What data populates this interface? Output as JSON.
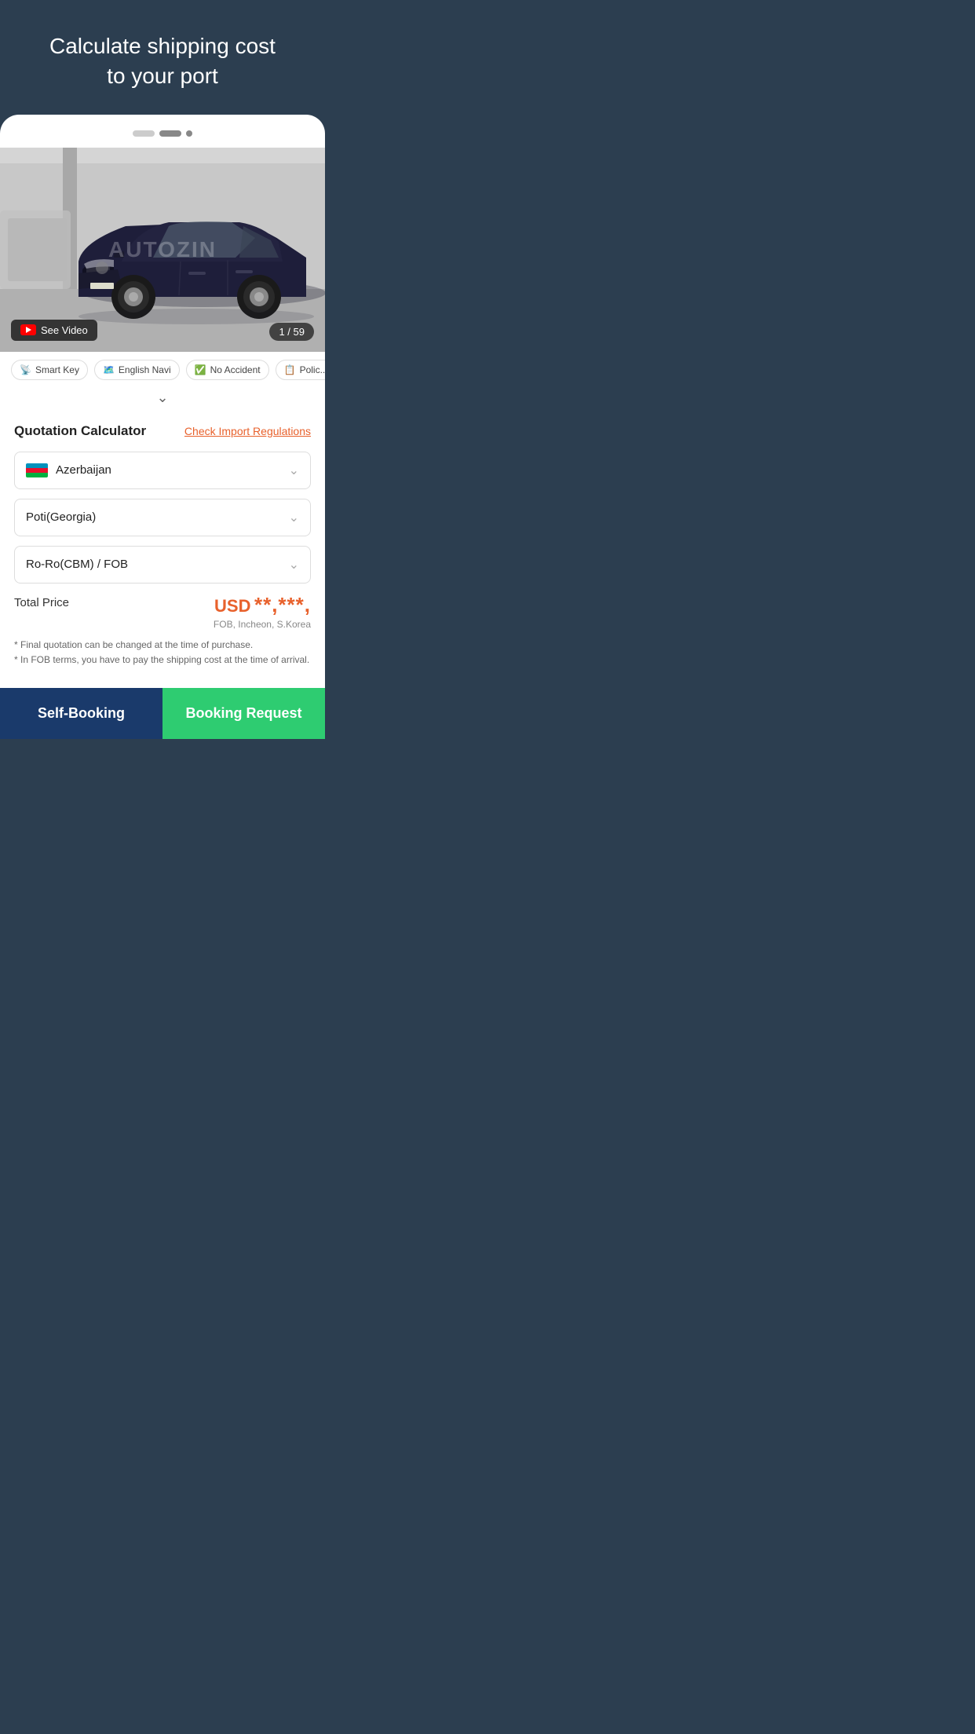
{
  "hero": {
    "title": "Calculate shipping cost\nto your port"
  },
  "pagination": {
    "dots": [
      {
        "type": "long",
        "active": false
      },
      {
        "type": "circle",
        "active": true
      },
      {
        "type": "circle-small",
        "active": true
      }
    ]
  },
  "car_image": {
    "see_video_label": "See Video",
    "counter": "1 / 59",
    "watermark": "AUTOZIN"
  },
  "features": [
    {
      "icon": "📡",
      "label": "Smart Key"
    },
    {
      "icon": "🗺️",
      "label": "English Navi"
    },
    {
      "icon": "✅",
      "label": "No Accident"
    },
    {
      "icon": "📋",
      "label": "Polic..."
    }
  ],
  "quotation": {
    "title": "Quotation Calculator",
    "check_import_link": "Check Import Regulations",
    "country_dropdown": {
      "value": "Azerbaijan",
      "has_flag": true
    },
    "port_dropdown": {
      "value": "Poti(Georgia)"
    },
    "shipping_method_dropdown": {
      "value": "Ro-Ro(CBM) / FOB"
    },
    "total_price": {
      "label": "Total Price",
      "currency": "USD",
      "value": "**,***,",
      "sub": "FOB, Incheon, S.Korea"
    },
    "footnotes": [
      "* Final quotation can be changed at the time of purchase.",
      "* In FOB terms, you have to pay the shipping cost at the time of arrival."
    ]
  },
  "buttons": {
    "self_booking": "Self-Booking",
    "booking_request": "Booking Request"
  }
}
